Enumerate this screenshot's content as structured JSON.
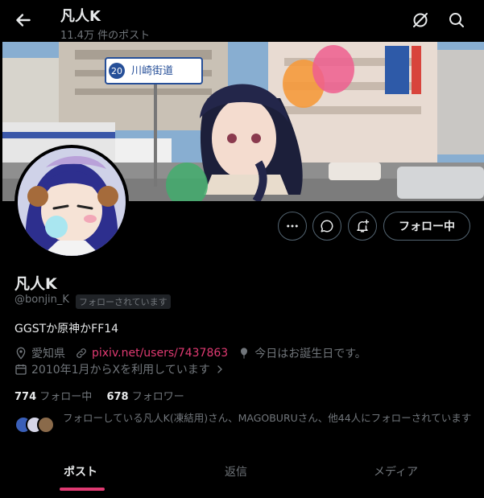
{
  "header": {
    "title": "凡人K",
    "subtitle": "11.4万 件のポスト"
  },
  "profile": {
    "name": "凡人K",
    "handle": "@bonjin_K",
    "follows_you": "フォローされています",
    "bio": "GGSTか原神かFF14",
    "location": "愛知県",
    "link": "pixiv.net/users/7437863",
    "birthday": "今日はお誕生日です。",
    "joined": "2010年1月からXを利用しています",
    "following_count": "774",
    "following_label": "フォロー中",
    "followers_count": "678",
    "followers_label": "フォロワー",
    "followed_by": "フォローしている凡人K(凍結用)さん、MAGOBURUさん、他44人にフォローされています"
  },
  "banner": {
    "sign_number": "20",
    "sign_text": "川崎街道"
  },
  "buttons": {
    "follow": "フォロー中"
  },
  "tabs": [
    {
      "label": "ポスト",
      "active": true
    },
    {
      "label": "返信",
      "active": false
    },
    {
      "label": "メディア",
      "active": false
    }
  ],
  "colors": {
    "accent": "#e03a72",
    "background": "#000000",
    "muted": "#71767b"
  }
}
